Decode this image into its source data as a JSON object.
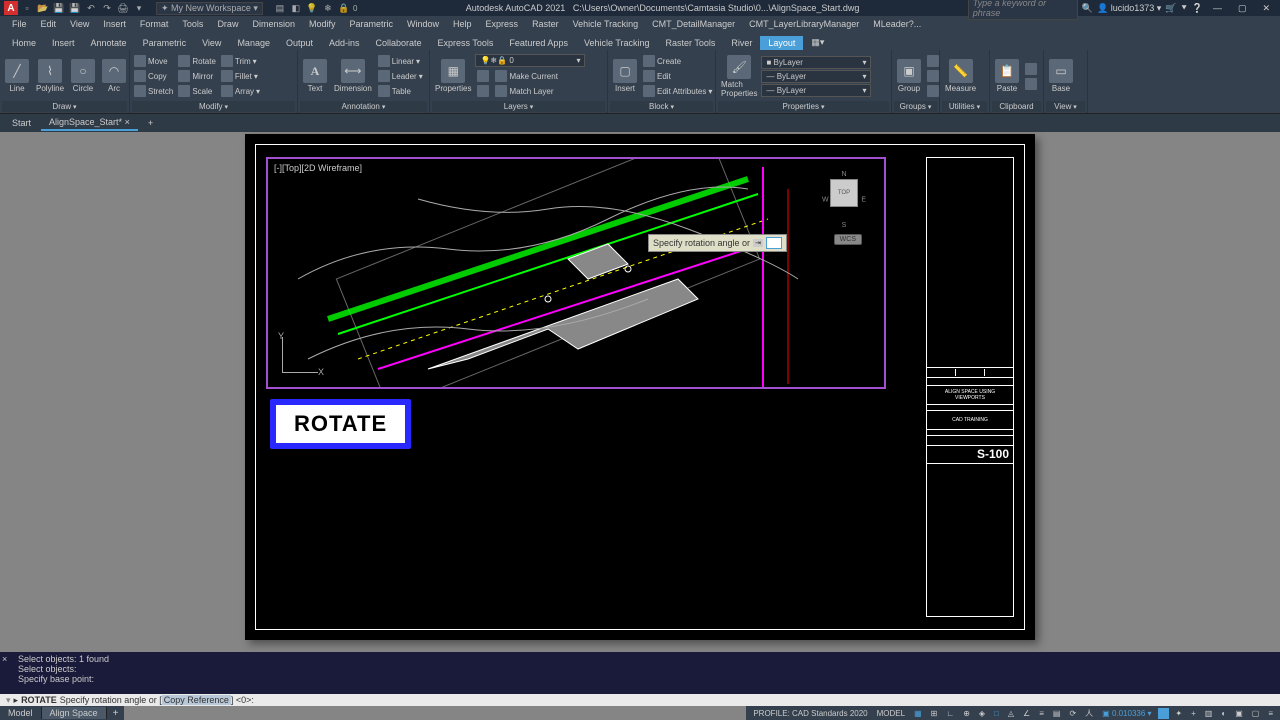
{
  "title": {
    "workspace": "My New Workspace",
    "app": "Autodesk AutoCAD 2021",
    "file": "C:\\Users\\Owner\\Documents\\Camtasia Studio\\0...\\AlignSpace_Start.dwg",
    "search_placeholder": "Type a keyword or phrase",
    "user": "lucido1373"
  },
  "menus": [
    "File",
    "Edit",
    "View",
    "Insert",
    "Format",
    "Tools",
    "Draw",
    "Dimension",
    "Modify",
    "Parametric",
    "Window",
    "Help",
    "Express",
    "Raster",
    "Vehicle Tracking",
    "CMT_DetailManager",
    "CMT_LayerLibraryManager",
    "MLeader?..."
  ],
  "ribbon_tabs": [
    "Home",
    "Insert",
    "Annotate",
    "Parametric",
    "View",
    "Manage",
    "Output",
    "Add-ins",
    "Collaborate",
    "Express Tools",
    "Featured Apps",
    "Vehicle Tracking",
    "Raster Tools",
    "River",
    "Layout"
  ],
  "active_tab": "Layout",
  "panels": {
    "draw": {
      "title": "Draw",
      "btns": [
        "Line",
        "Polyline",
        "Circle",
        "Arc"
      ]
    },
    "modify": {
      "title": "Modify",
      "rows": [
        [
          "Move",
          "Rotate",
          "Trim"
        ],
        [
          "Copy",
          "Mirror",
          "Fillet"
        ],
        [
          "Stretch",
          "Scale",
          "Array"
        ]
      ]
    },
    "annotation": {
      "title": "Annotation",
      "text": "Text",
      "dim": "Dimension",
      "items": [
        "Linear",
        "Leader",
        "Table"
      ]
    },
    "layers": {
      "title": "Layers",
      "props": "Properties",
      "dd": "0",
      "items": [
        "Make Current",
        "Match Layer"
      ]
    },
    "block": {
      "title": "Block",
      "insert": "Insert",
      "items": [
        "Create",
        "Edit",
        "Edit Attributes"
      ]
    },
    "properties": {
      "title": "Properties",
      "match": "Match\nProperties",
      "dd": [
        "ByLayer",
        "ByLayer",
        "ByLayer"
      ]
    },
    "groups": {
      "title": "Groups",
      "label": "Group"
    },
    "utilities": {
      "title": "Utilities",
      "label": "Measure"
    },
    "clipboard": {
      "title": "Clipboard",
      "label": "Paste"
    },
    "view": {
      "title": "View",
      "label": "Base"
    }
  },
  "file_tabs": [
    "Start",
    "AlignSpace_Start*"
  ],
  "viewport_label": "[-][Top][2D Wireframe]",
  "tooltip": "Specify rotation angle or",
  "compass": {
    "n": "N",
    "s": "S",
    "e": "E",
    "w": "W",
    "top": "TOP",
    "wcs": "WCS"
  },
  "ucs": {
    "x": "X",
    "y": "Y"
  },
  "rotate_badge": "ROTATE",
  "titleblock": {
    "title1": "ALIGN SPACE USING",
    "title2": "VIEWPORTS",
    "company": "CAD TRAINING",
    "sheet": "S-100"
  },
  "cmd_history": [
    "Select objects: 1 found",
    "Select objects:",
    "Specify base point:"
  ],
  "cmdline": {
    "arrow": "▸",
    "cmd": "ROTATE",
    "text": "Specify rotation angle or [",
    "opt": "Copy Reference",
    "tail": "] <0>:"
  },
  "model_tabs": [
    "Model",
    "Align Space"
  ],
  "status": {
    "profile": "PROFILE: CAD Standards 2020",
    "model": "MODEL",
    "coord": "0.010336"
  }
}
